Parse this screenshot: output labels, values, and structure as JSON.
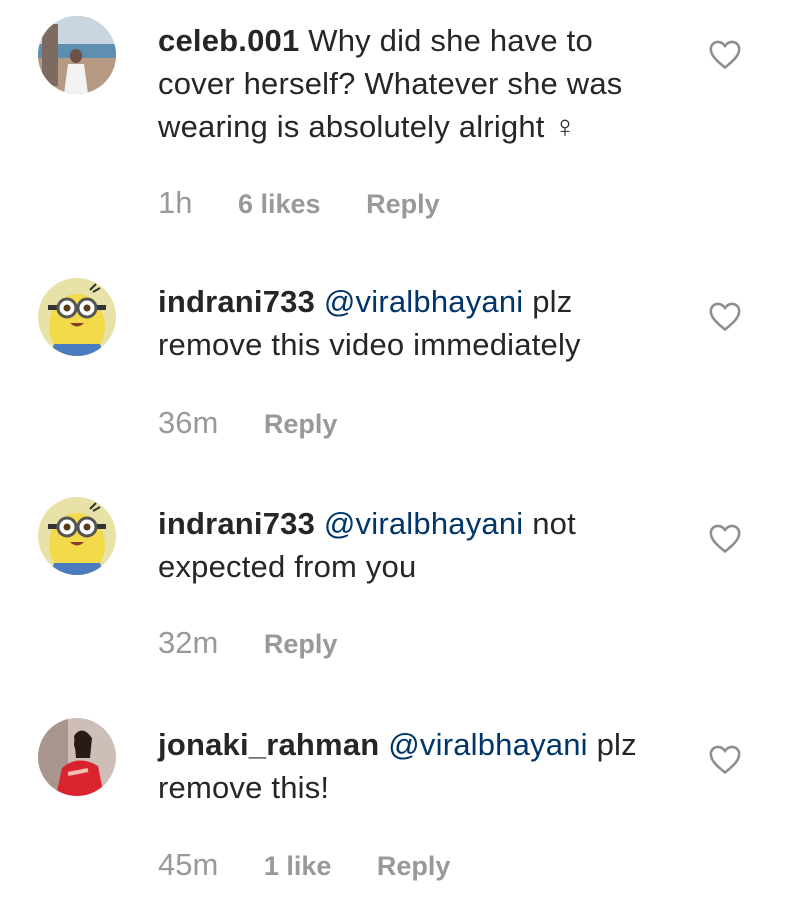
{
  "comments": [
    {
      "username": "celeb.001",
      "mention": "",
      "text": "Why did she have to cover herself? Whatever she was wearing is absolutely alright ♀",
      "time": "1h",
      "likes": "6 likes",
      "reply": "Reply",
      "avatar": "beach-photo-avatar"
    },
    {
      "username": "indrani733",
      "mention": "@viralbhayani",
      "text": "plz remove this video immediately",
      "time": "36m",
      "likes": "",
      "reply": "Reply",
      "avatar": "minion-avatar"
    },
    {
      "username": "indrani733",
      "mention": "@viralbhayani",
      "text": "not expected from you",
      "time": "32m",
      "likes": "",
      "reply": "Reply",
      "avatar": "minion-avatar"
    },
    {
      "username": "jonaki_rahman",
      "mention": "@viralbhayani",
      "text": "plz remove this!",
      "time": "45m",
      "likes": "1 like",
      "reply": "Reply",
      "avatar": "red-dress-photo-avatar"
    }
  ],
  "colors": {
    "text": "#262626",
    "mention": "#003569",
    "meta": "#999999",
    "heart_outline": "#8e8e8e"
  }
}
